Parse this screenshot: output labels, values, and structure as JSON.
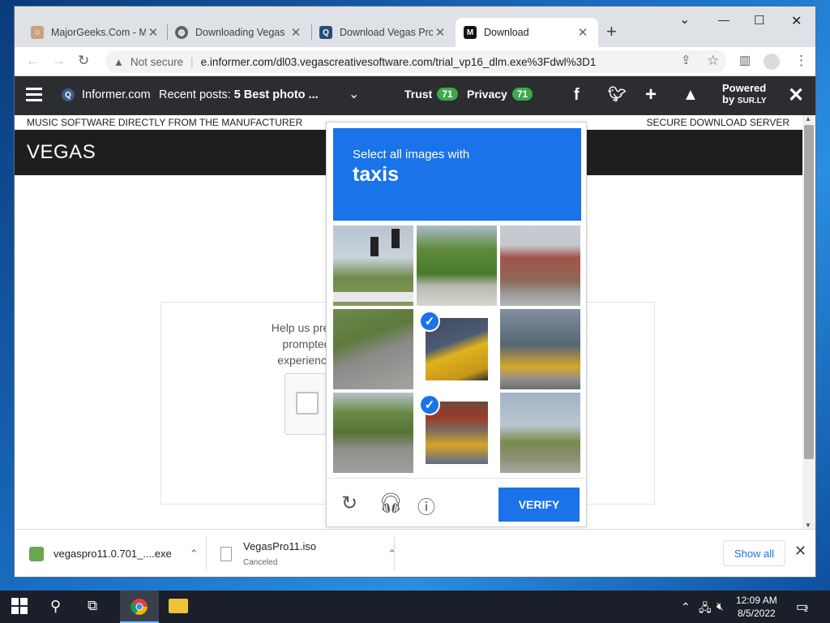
{
  "browser": {
    "tabs": [
      {
        "title": "MajorGeeks.Com - M",
        "icon": "majorgeeks-favicon"
      },
      {
        "title": "Downloading Vegas P",
        "icon": "globe-icon"
      },
      {
        "title": "Download Vegas Pro",
        "icon": "informer-favicon"
      },
      {
        "title": "Download",
        "icon": "m-favicon",
        "active": true
      }
    ],
    "address": {
      "not_secure": "Not secure",
      "url": "e.informer.com/dl03.vegascreativesoftware.com/trial_vp16_dlm.exe%3Fdwl%3D1"
    }
  },
  "infobar": {
    "site": "Informer.com",
    "recent_label": "Recent posts:",
    "recent_title": "5 Best photo ...",
    "trust_label": "Trust",
    "trust_score": "71",
    "privacy_label": "Privacy",
    "privacy_score": "71",
    "powered_1": "Powered",
    "powered_2": "by",
    "powered_brand": "SUR.LY"
  },
  "page": {
    "strip_left": "MUSIC SOFTWARE DIRECTLY FROM THE MANUFACTURER",
    "strip_right": "SECURE DOWNLOAD SERVER",
    "brand": "VEGAS",
    "help_lines": [
      "Help us preve",
      "prompted",
      "experiencin"
    ]
  },
  "captcha": {
    "instruction": "Select all images with",
    "target": "taxis",
    "verify_label": "VERIFY",
    "tiles": [
      {
        "name": "traffic-light",
        "selected": false
      },
      {
        "name": "street-trees",
        "selected": false
      },
      {
        "name": "store-building",
        "selected": false
      },
      {
        "name": "cyclists-road",
        "selected": false
      },
      {
        "name": "yellow-taxi",
        "selected": true
      },
      {
        "name": "city-street-taxis",
        "selected": false
      },
      {
        "name": "suburban-road",
        "selected": false
      },
      {
        "name": "new-york-taxi",
        "selected": true
      },
      {
        "name": "roadside-field",
        "selected": false
      }
    ]
  },
  "downloads": {
    "item1": {
      "name": "vegaspro11.0.701_....exe"
    },
    "item2": {
      "name": "VegasPro11.iso",
      "status": "Canceled"
    },
    "show_all": "Show all"
  },
  "taskbar": {
    "time": "12:09 AM",
    "date": "8/5/2022",
    "notifications": "2"
  },
  "colors": {
    "accent": "#1a73e8",
    "trust": "#3da94a"
  }
}
